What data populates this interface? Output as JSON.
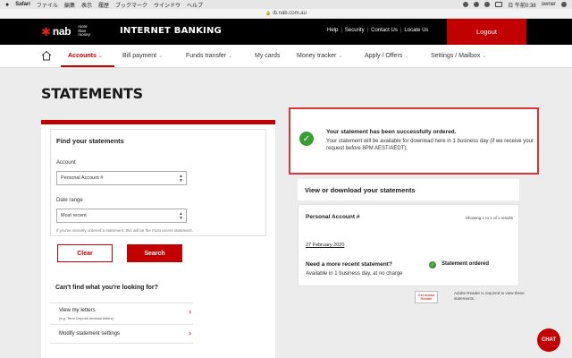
{
  "macbar": {
    "apple": "",
    "app": "Safari",
    "menus": [
      "ファイル",
      "編集",
      "表示",
      "履歴",
      "ブックマーク",
      "ウインドウ",
      "ヘルプ"
    ],
    "clock": "日 午前0:38",
    "user": "owner"
  },
  "browser": {
    "url": "ib.nab.com.au"
  },
  "header": {
    "logo_text": "nab",
    "logo_tag": "more than money",
    "title": "INTERNET BANKING",
    "links": [
      "Help",
      "Security",
      "Contact Us",
      "Locate Us"
    ],
    "logout": "Logout"
  },
  "nav": {
    "items": [
      {
        "label": "Accounts",
        "has_menu": true,
        "active": true
      },
      {
        "label": "Bill payment",
        "has_menu": true
      },
      {
        "label": "Funds transfer",
        "has_menu": true
      },
      {
        "label": "My cards",
        "has_menu": false
      },
      {
        "label": "Money tracker",
        "has_menu": true
      },
      {
        "label": "Apply / Offers",
        "has_menu": true
      },
      {
        "label": "Settings / Mailbox",
        "has_menu": true
      }
    ]
  },
  "page": {
    "title": "STATEMENTS"
  },
  "find": {
    "title": "Find your statements",
    "account_label": "Account",
    "account_value": "Personal Account #",
    "range_label": "Date range",
    "range_value": "Most recent",
    "hint": "If you've recently ordered a statement, this will be the most recent statement.",
    "clear": "Clear",
    "search": "Search",
    "cant_find": "Can't find what you're looking for?",
    "links": [
      {
        "title": "View my letters",
        "sub": "(e.g. Term Deposit renewal letters)"
      },
      {
        "title": "Modify statement settings",
        "sub": ""
      }
    ]
  },
  "success": {
    "title": "Your statement has been successfully ordered.",
    "body": "Your statement will be available for download here in 1 business day (if we receive your request before 8PM AEST/AEDT)."
  },
  "view": {
    "title": "View or download your statements",
    "account": "Personal Account #",
    "showing": "Showing 1 to 1 of 1 results",
    "date": "27 February 2020",
    "need_title": "Need a more recent statement?",
    "need_body": "Available in 1 business day, at no charge",
    "ordered": "Statement ordered"
  },
  "adobe": {
    "badge": "Get Adobe Reader",
    "text": "Adobe Reader is required to view these statements."
  },
  "chat": "CHAT",
  "colors": {
    "brand_red": "#c20000",
    "success_green": "#3a9c35",
    "header_black": "#000000"
  }
}
